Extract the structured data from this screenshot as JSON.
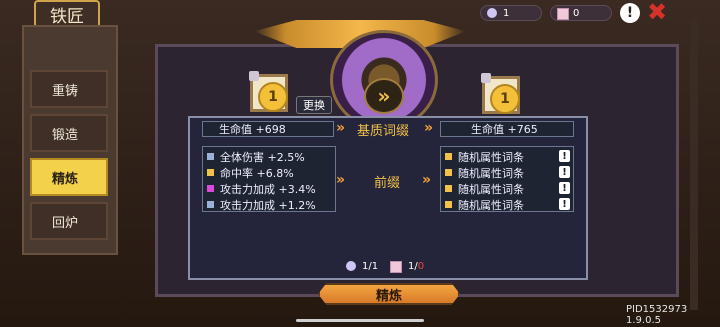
{
  "header": {
    "title": "铁匠"
  },
  "currency": {
    "gems": "1",
    "cards": "0"
  },
  "tabs": [
    {
      "label": "重铸",
      "active": false
    },
    {
      "label": "锻造",
      "active": false
    },
    {
      "label": "精炼",
      "active": true
    },
    {
      "label": "回炉",
      "active": false
    }
  ],
  "slots": {
    "left_coin": "1",
    "right_coin": "1",
    "swap_label": "更换"
  },
  "base": {
    "left": "生命值 +698",
    "label": "基质词缀",
    "right": "生命值 +765"
  },
  "prefix": {
    "label": "前缀",
    "left": [
      {
        "text": "全体伤害 +2.5%"
      },
      {
        "text": "命中率 +6.8%"
      },
      {
        "text": "攻击力加成 +3.4%"
      },
      {
        "text": "攻击力加成 +1.2%"
      }
    ],
    "right": [
      {
        "text": "随机属性词条"
      },
      {
        "text": "随机属性词条"
      },
      {
        "text": "随机属性词条"
      },
      {
        "text": "随机属性词条"
      }
    ]
  },
  "costs": {
    "gem": "1/1",
    "card": "1/",
    "card_need": "0"
  },
  "actions": {
    "refine": "精炼"
  },
  "footer": {
    "pid": "PID1532973 1.9.0.5"
  },
  "icons": {
    "info": "!",
    "close": "✖",
    "arrow": "»",
    "excl": "!"
  },
  "colors": {
    "active_tab": "#f3d14a",
    "accent": "#f2a33a",
    "close": "#d6322c"
  }
}
